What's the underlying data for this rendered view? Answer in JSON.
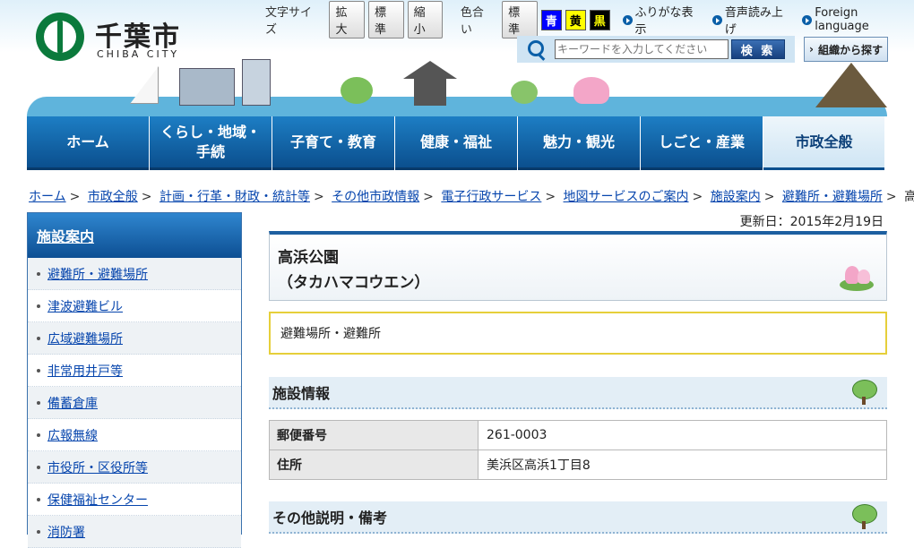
{
  "site": {
    "name_jp": "千葉市",
    "name_en": "CHIBA CITY"
  },
  "tools": {
    "font_size_label": "文字サイズ",
    "font_buttons": [
      "拡大",
      "標準",
      "縮小"
    ],
    "color_label": "色合い",
    "color_buttons": [
      "標準",
      "青",
      "黄",
      "黒"
    ],
    "furigana": "ふりがな表示",
    "read_aloud": "音声読み上げ",
    "foreign": "Foreign language"
  },
  "search": {
    "placeholder": "キーワードを入力してください",
    "button": "検 索",
    "org_button": "組織から探す"
  },
  "nav": {
    "items": [
      {
        "label": "ホーム"
      },
      {
        "label": "くらし・地域・\n手続"
      },
      {
        "label": "子育て・教育"
      },
      {
        "label": "健康・福祉"
      },
      {
        "label": "魅力・観光"
      },
      {
        "label": "しごと・産業"
      },
      {
        "label": "市政全般"
      }
    ],
    "active_index": 6
  },
  "breadcrumb": {
    "items": [
      "ホーム",
      "市政全般",
      "計画・行革・財政・統計等",
      "その他市政情報",
      "電子行政サービス",
      "地図サービスのご案内",
      "施設案内",
      "避難所・避難場所"
    ],
    "separator": ">",
    "current": "高浜公園"
  },
  "sidebar": {
    "title": "施設案内",
    "items": [
      "避難所・避難場所",
      "津波避難ビル",
      "広域避難場所",
      "非常用井戸等",
      "備蓄倉庫",
      "広報無線",
      "市役所・区役所等",
      "保健福祉センター",
      "消防署"
    ]
  },
  "page": {
    "updated": "更新日：2015年2月19日",
    "title": "高浜公園\n（タカハマコウエン）",
    "category": "避難場所・避難所",
    "section1": "施設情報",
    "table": [
      {
        "label": "郵便番号",
        "value": "261-0003"
      },
      {
        "label": "住所",
        "value": "美浜区高浜1丁目8"
      }
    ],
    "section2": "その他説明・備考"
  },
  "colors": {
    "nav_blue": "#0b4f8e",
    "link": "#0645ad",
    "category_border": "#e6cf3a"
  }
}
